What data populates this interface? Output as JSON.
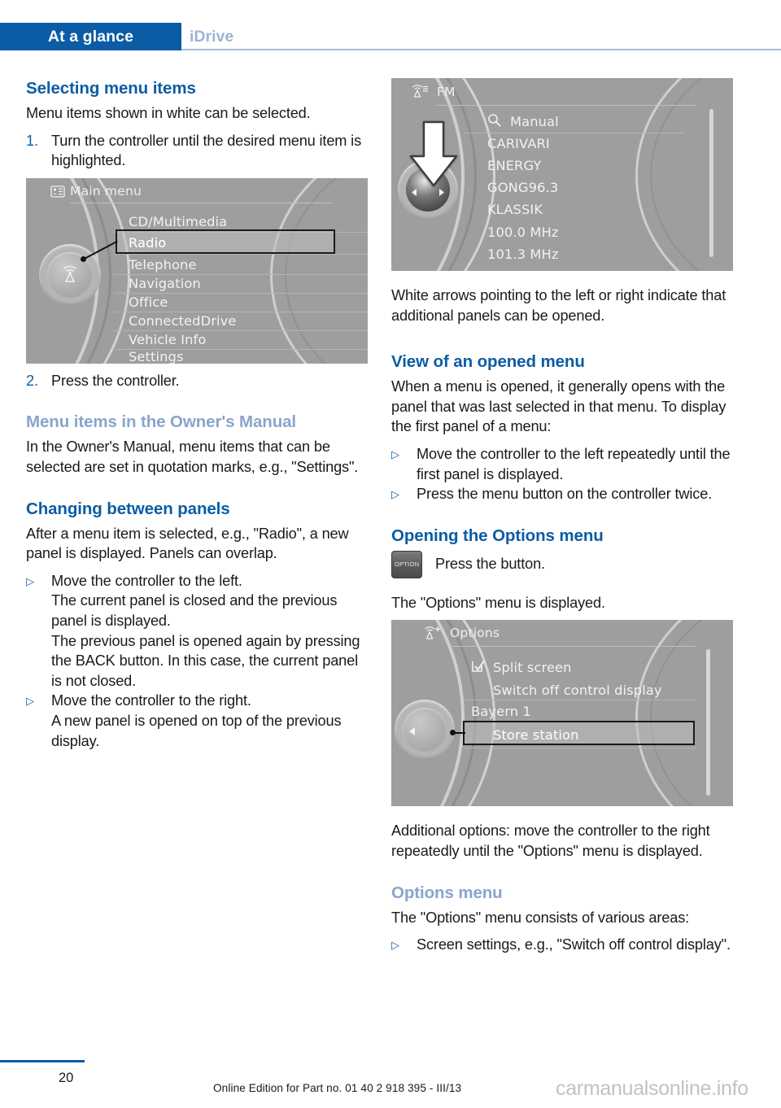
{
  "header": {
    "active_tab": "At a glance",
    "inactive_tab": "iDrive"
  },
  "left_column": {
    "heading_1": "Selecting menu items",
    "intro": "Menu items shown in white can be selected.",
    "step_1_marker": "1.",
    "step_1_text": "Turn the controller until the desired menu item is highlighted.",
    "step_2_marker": "2.",
    "step_2_text": "Press the controller.",
    "heading_2": "Menu items in the Owner's Manual",
    "para_2": "In the Owner's Manual, menu items that can be selected are set in quotation marks, e.g., \"Settings\".",
    "heading_3": "Changing between panels",
    "para_3": "After a menu item is selected, e.g., \"Radio\", a new panel is displayed. Panels can overlap.",
    "bullet_marker": "▷",
    "bullet_1": "Move the controller to the left.",
    "bullet_1_sub_a": "The current panel is closed and the previous panel is displayed.",
    "bullet_1_sub_b": "The previous panel is opened again by pressing the BACK button. In this case, the current panel is not closed.",
    "bullet_2": "Move the controller to the right.",
    "bullet_2_sub_a": "A new panel is opened on top of the previous display."
  },
  "main_menu_screen": {
    "title": "Main menu",
    "items": [
      "CD/Multimedia",
      "Radio",
      "Telephone",
      "Navigation",
      "Office",
      "ConnectedDrive",
      "Vehicle Info",
      "Settings"
    ],
    "highlighted_item": "Radio"
  },
  "fm_screen": {
    "title": "FM",
    "search_label": "Manual",
    "items": [
      "CARIVARI",
      "ENERGY",
      "GONG96.3",
      "KLASSIK",
      "100.0  MHz",
      "101.3  MHz"
    ]
  },
  "options_screen": {
    "title": "Options",
    "checkbox_item": "Split screen",
    "item_2": "Switch off control display",
    "item_3": "Bayern 1",
    "highlighted_item": "Store station"
  },
  "right_column": {
    "para_1": "White arrows pointing to the left or right indicate that additional panels can be opened.",
    "heading_1": "View of an opened menu",
    "para_2": "When a menu is opened, it generally opens with the panel that was last selected in that menu. To display the first panel of a menu:",
    "bullet_marker": "▷",
    "bullet_1": "Move the controller to the left repeatedly until the first panel is displayed.",
    "bullet_2": "Press the menu button on the controller twice.",
    "heading_2": "Opening the Options menu",
    "option_button_label": "OPTION",
    "option_press_text": "Press the button.",
    "para_3": "The \"Options\" menu is displayed.",
    "para_4": "Additional options: move the controller to the right repeatedly until the \"Options\" menu is displayed.",
    "heading_3": "Options menu",
    "para_5": "The \"Options\" menu consists of various areas:",
    "bullet_3": "Screen settings, e.g., \"Switch off control display\"."
  },
  "footer": {
    "page_number": "20",
    "edition_text": "Online Edition for Part no. 01 40 2 918 395 - III/13",
    "watermark": "carmanualsonline.info"
  },
  "colors": {
    "brand_blue": "#0b5ca5",
    "light_blue": "#8aa5cc",
    "tab_inactive": "#9db4d4",
    "rule": "#a9bcd6"
  }
}
